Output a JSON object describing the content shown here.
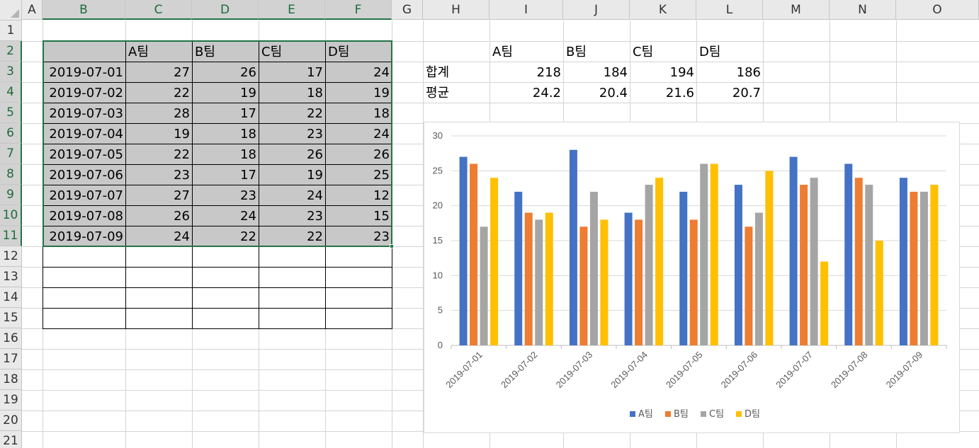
{
  "columns": [
    "A",
    "B",
    "C",
    "D",
    "E",
    "F",
    "G",
    "H",
    "I",
    "J",
    "K",
    "L",
    "M",
    "N",
    "O"
  ],
  "rows": [
    "1",
    "2",
    "3",
    "4",
    "5",
    "6",
    "7",
    "8",
    "9",
    "10",
    "11",
    "12",
    "13",
    "14",
    "15",
    "16",
    "17",
    "18",
    "19",
    "20",
    "21"
  ],
  "table": {
    "headers": [
      "A팀",
      "B팀",
      "C팀",
      "D팀"
    ],
    "rows": [
      {
        "date": "2019-07-01",
        "values": [
          "27",
          "26",
          "17",
          "24"
        ]
      },
      {
        "date": "2019-07-02",
        "values": [
          "22",
          "19",
          "18",
          "19"
        ]
      },
      {
        "date": "2019-07-03",
        "values": [
          "28",
          "17",
          "22",
          "18"
        ]
      },
      {
        "date": "2019-07-04",
        "values": [
          "19",
          "18",
          "23",
          "24"
        ]
      },
      {
        "date": "2019-07-05",
        "values": [
          "22",
          "18",
          "26",
          "26"
        ]
      },
      {
        "date": "2019-07-06",
        "values": [
          "23",
          "17",
          "19",
          "25"
        ]
      },
      {
        "date": "2019-07-07",
        "values": [
          "27",
          "23",
          "24",
          "12"
        ]
      },
      {
        "date": "2019-07-08",
        "values": [
          "26",
          "24",
          "23",
          "15"
        ]
      },
      {
        "date": "2019-07-09",
        "values": [
          "24",
          "22",
          "22",
          "23"
        ]
      }
    ]
  },
  "summary": {
    "headers": [
      "A팀",
      "B팀",
      "C팀",
      "D팀"
    ],
    "sum_label": "합계",
    "sum_values": [
      "218",
      "184",
      "194",
      "186"
    ],
    "avg_label": "평균",
    "avg_values": [
      "24.2",
      "20.4",
      "21.6",
      "20.7"
    ]
  },
  "chart_data": {
    "type": "bar",
    "categories": [
      "2019-07-01",
      "2019-07-02",
      "2019-07-03",
      "2019-07-04",
      "2019-07-05",
      "2019-07-06",
      "2019-07-07",
      "2019-07-08",
      "2019-07-09"
    ],
    "series": [
      {
        "name": "A팀",
        "color": "#4472c4",
        "values": [
          27,
          22,
          28,
          19,
          22,
          23,
          27,
          26,
          24
        ]
      },
      {
        "name": "B팀",
        "color": "#ed7d31",
        "values": [
          26,
          19,
          17,
          18,
          18,
          17,
          23,
          24,
          22
        ]
      },
      {
        "name": "C팀",
        "color": "#a5a5a5",
        "values": [
          17,
          18,
          22,
          23,
          26,
          19,
          24,
          23,
          22
        ]
      },
      {
        "name": "D팀",
        "color": "#ffc000",
        "values": [
          24,
          19,
          18,
          24,
          26,
          25,
          12,
          15,
          23
        ]
      }
    ],
    "yticks": [
      "0",
      "5",
      "10",
      "15",
      "20",
      "25",
      "30"
    ],
    "ylim": [
      0,
      30
    ],
    "grid": true,
    "legend": "bottom"
  }
}
